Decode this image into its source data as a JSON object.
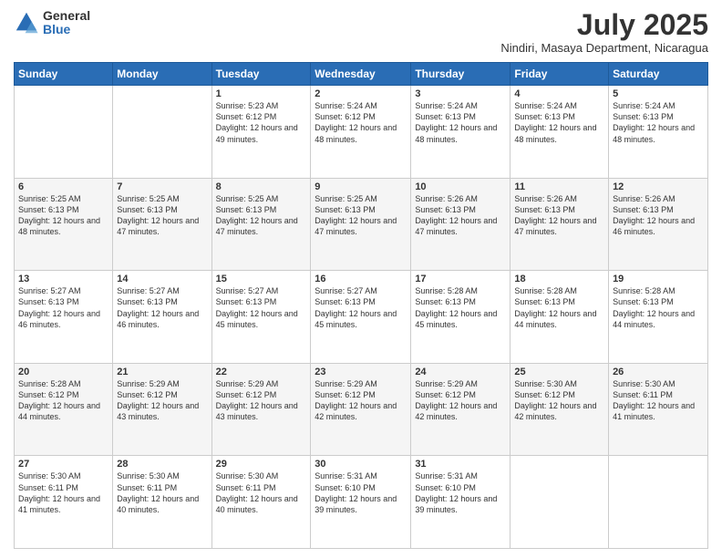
{
  "logo": {
    "general": "General",
    "blue": "Blue"
  },
  "header": {
    "month": "July 2025",
    "location": "Nindiri, Masaya Department, Nicaragua"
  },
  "weekdays": [
    "Sunday",
    "Monday",
    "Tuesday",
    "Wednesday",
    "Thursday",
    "Friday",
    "Saturday"
  ],
  "weeks": [
    [
      {
        "day": "",
        "info": ""
      },
      {
        "day": "",
        "info": ""
      },
      {
        "day": "1",
        "sunrise": "5:23 AM",
        "sunset": "6:12 PM",
        "daylight": "12 hours and 49 minutes."
      },
      {
        "day": "2",
        "sunrise": "5:24 AM",
        "sunset": "6:12 PM",
        "daylight": "12 hours and 48 minutes."
      },
      {
        "day": "3",
        "sunrise": "5:24 AM",
        "sunset": "6:13 PM",
        "daylight": "12 hours and 48 minutes."
      },
      {
        "day": "4",
        "sunrise": "5:24 AM",
        "sunset": "6:13 PM",
        "daylight": "12 hours and 48 minutes."
      },
      {
        "day": "5",
        "sunrise": "5:24 AM",
        "sunset": "6:13 PM",
        "daylight": "12 hours and 48 minutes."
      }
    ],
    [
      {
        "day": "6",
        "sunrise": "5:25 AM",
        "sunset": "6:13 PM",
        "daylight": "12 hours and 48 minutes."
      },
      {
        "day": "7",
        "sunrise": "5:25 AM",
        "sunset": "6:13 PM",
        "daylight": "12 hours and 47 minutes."
      },
      {
        "day": "8",
        "sunrise": "5:25 AM",
        "sunset": "6:13 PM",
        "daylight": "12 hours and 47 minutes."
      },
      {
        "day": "9",
        "sunrise": "5:25 AM",
        "sunset": "6:13 PM",
        "daylight": "12 hours and 47 minutes."
      },
      {
        "day": "10",
        "sunrise": "5:26 AM",
        "sunset": "6:13 PM",
        "daylight": "12 hours and 47 minutes."
      },
      {
        "day": "11",
        "sunrise": "5:26 AM",
        "sunset": "6:13 PM",
        "daylight": "12 hours and 47 minutes."
      },
      {
        "day": "12",
        "sunrise": "5:26 AM",
        "sunset": "6:13 PM",
        "daylight": "12 hours and 46 minutes."
      }
    ],
    [
      {
        "day": "13",
        "sunrise": "5:27 AM",
        "sunset": "6:13 PM",
        "daylight": "12 hours and 46 minutes."
      },
      {
        "day": "14",
        "sunrise": "5:27 AM",
        "sunset": "6:13 PM",
        "daylight": "12 hours and 46 minutes."
      },
      {
        "day": "15",
        "sunrise": "5:27 AM",
        "sunset": "6:13 PM",
        "daylight": "12 hours and 45 minutes."
      },
      {
        "day": "16",
        "sunrise": "5:27 AM",
        "sunset": "6:13 PM",
        "daylight": "12 hours and 45 minutes."
      },
      {
        "day": "17",
        "sunrise": "5:28 AM",
        "sunset": "6:13 PM",
        "daylight": "12 hours and 45 minutes."
      },
      {
        "day": "18",
        "sunrise": "5:28 AM",
        "sunset": "6:13 PM",
        "daylight": "12 hours and 44 minutes."
      },
      {
        "day": "19",
        "sunrise": "5:28 AM",
        "sunset": "6:13 PM",
        "daylight": "12 hours and 44 minutes."
      }
    ],
    [
      {
        "day": "20",
        "sunrise": "5:28 AM",
        "sunset": "6:12 PM",
        "daylight": "12 hours and 44 minutes."
      },
      {
        "day": "21",
        "sunrise": "5:29 AM",
        "sunset": "6:12 PM",
        "daylight": "12 hours and 43 minutes."
      },
      {
        "day": "22",
        "sunrise": "5:29 AM",
        "sunset": "6:12 PM",
        "daylight": "12 hours and 43 minutes."
      },
      {
        "day": "23",
        "sunrise": "5:29 AM",
        "sunset": "6:12 PM",
        "daylight": "12 hours and 42 minutes."
      },
      {
        "day": "24",
        "sunrise": "5:29 AM",
        "sunset": "6:12 PM",
        "daylight": "12 hours and 42 minutes."
      },
      {
        "day": "25",
        "sunrise": "5:30 AM",
        "sunset": "6:12 PM",
        "daylight": "12 hours and 42 minutes."
      },
      {
        "day": "26",
        "sunrise": "5:30 AM",
        "sunset": "6:11 PM",
        "daylight": "12 hours and 41 minutes."
      }
    ],
    [
      {
        "day": "27",
        "sunrise": "5:30 AM",
        "sunset": "6:11 PM",
        "daylight": "12 hours and 41 minutes."
      },
      {
        "day": "28",
        "sunrise": "5:30 AM",
        "sunset": "6:11 PM",
        "daylight": "12 hours and 40 minutes."
      },
      {
        "day": "29",
        "sunrise": "5:30 AM",
        "sunset": "6:11 PM",
        "daylight": "12 hours and 40 minutes."
      },
      {
        "day": "30",
        "sunrise": "5:31 AM",
        "sunset": "6:10 PM",
        "daylight": "12 hours and 39 minutes."
      },
      {
        "day": "31",
        "sunrise": "5:31 AM",
        "sunset": "6:10 PM",
        "daylight": "12 hours and 39 minutes."
      },
      {
        "day": "",
        "info": ""
      },
      {
        "day": "",
        "info": ""
      }
    ]
  ]
}
